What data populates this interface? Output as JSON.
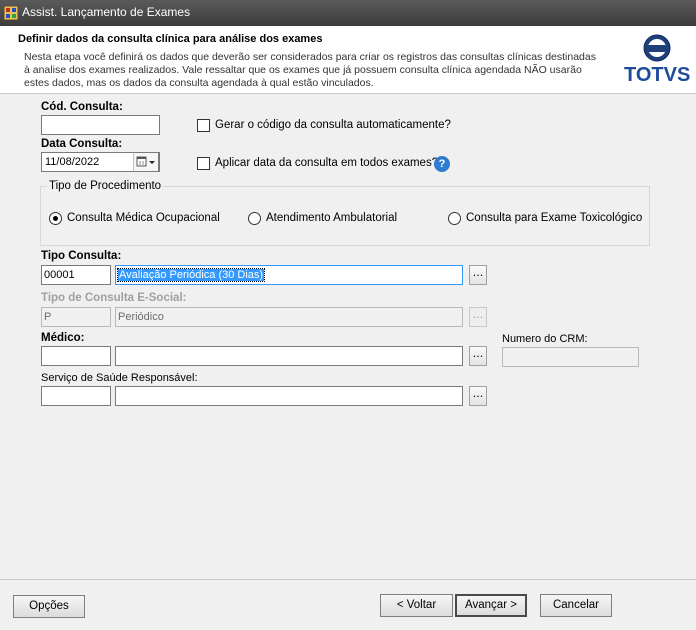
{
  "window": {
    "title": "Assist. Lançamento de Exames"
  },
  "header": {
    "title": "Definir dados da consulta clínica para análise dos exames",
    "description": "Nesta etapa você definirá os dados que deverão ser considerados para criar os registros das consultas clínicas destinadas à analise dos exames realizados. Vale ressaltar que os exames que já possuem consulta clínica agendada NÃO usarão estes dados, mas os dados da consulta agendada à qual estão vinculados.",
    "logo_text": "TOTVS"
  },
  "form": {
    "cod_consulta": {
      "label": "Cód. Consulta:",
      "value": ""
    },
    "gerar_codigo": {
      "label": "Gerar o código da consulta automaticamente?",
      "checked": false
    },
    "data_consulta": {
      "label": "Data Consulta:",
      "value": "11/08/2022"
    },
    "aplicar_data": {
      "label": "Aplicar data da consulta em todos exames?",
      "checked": false
    },
    "help_symbol": "?",
    "tipo_procedimento": {
      "title": "Tipo de Procedimento",
      "options": [
        {
          "label": "Consulta Médica Ocupacional",
          "selected": true
        },
        {
          "label": "Atendimento Ambulatorial",
          "selected": false
        },
        {
          "label": "Consulta para Exame Toxicológico",
          "selected": false
        }
      ]
    },
    "tipo_consulta": {
      "label": "Tipo Consulta:",
      "code": "00001",
      "description": "Avaliação Periódica (30 Dias)"
    },
    "tipo_esocial": {
      "label": "Tipo de Consulta E-Social:",
      "code": "P",
      "description": "Periódico"
    },
    "medico": {
      "label": "Médico:",
      "code": "",
      "name": ""
    },
    "crm": {
      "label": "Numero do CRM:",
      "value": ""
    },
    "servico_saude": {
      "label": "Serviço de Saúde Responsável:",
      "code": "",
      "name": ""
    },
    "ellipsis": "..."
  },
  "footer": {
    "options_label": "Opções",
    "back_label": "< Voltar",
    "next_label": "Avançar >",
    "cancel_label": "Cancelar"
  },
  "colors": {
    "selection": "#3399ff",
    "brand": "#1e4b9c",
    "titlebar": "#3c3c3c"
  }
}
